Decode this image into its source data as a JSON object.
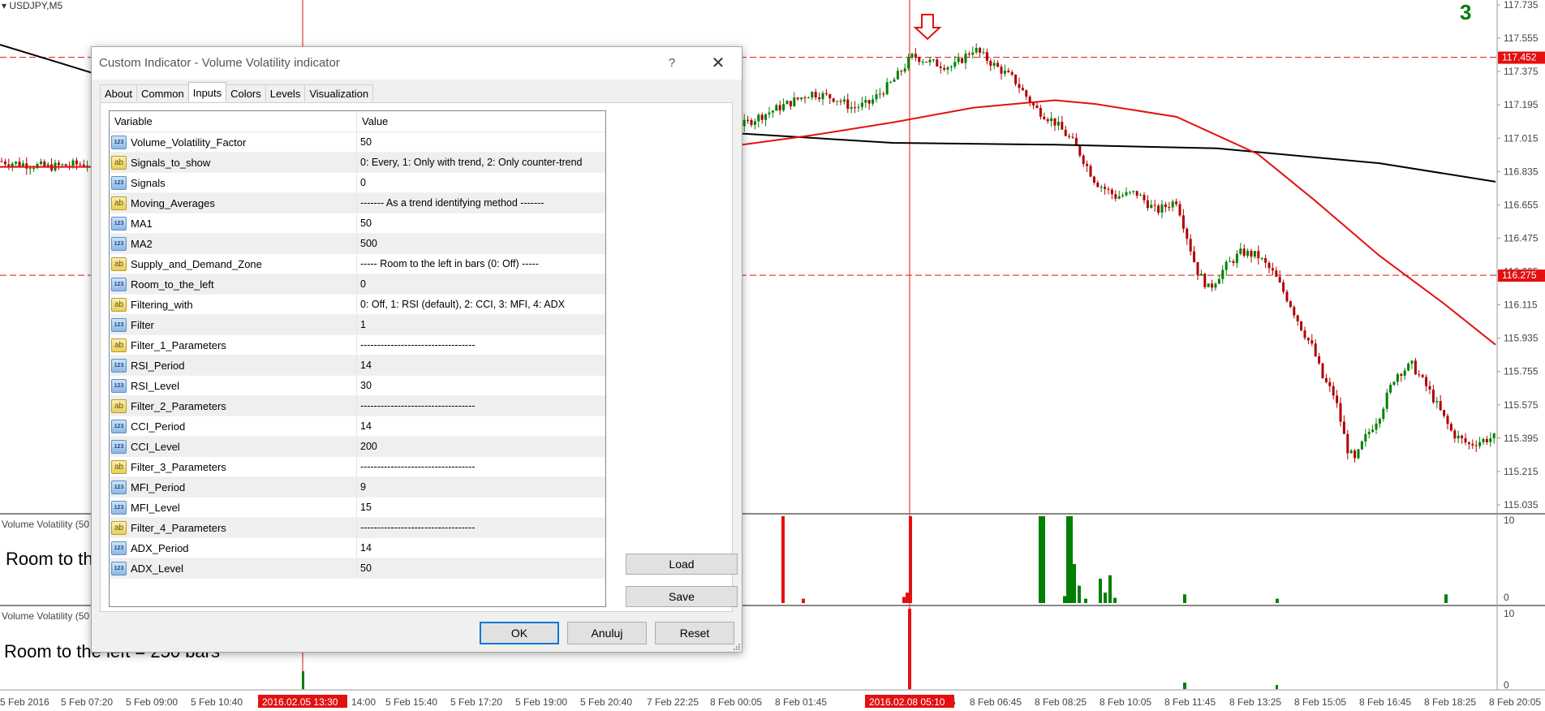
{
  "chart": {
    "symbol_label": "USDJPY,M5",
    "counter": "3",
    "price_ticks": [
      "117.735",
      "117.555",
      "117.375",
      "117.195",
      "117.015",
      "116.835",
      "116.655",
      "116.475",
      "116.295",
      "116.115",
      "115.935",
      "115.755",
      "115.575",
      "115.395",
      "115.215",
      "115.035"
    ],
    "price_tags": [
      {
        "value": "117.452",
        "price": 117.452
      },
      {
        "value": "116.275",
        "price": 116.275
      }
    ],
    "subwindow1": {
      "label": "Volume Volatility (50",
      "note": "Room to th",
      "scale_top": "10",
      "scale_bottom": "0"
    },
    "subwindow2": {
      "label": "Volume Volatility (50",
      "note": "Room to the left = 250 bars",
      "scale_top": "10",
      "scale_bottom": "0"
    },
    "time_labels": [
      "5 Feb 2016",
      "5 Feb 07:20",
      "5 Feb 09:00",
      "5 Feb 10:40",
      "14:00",
      "5 Feb 15:40",
      "5 Feb 17:20",
      "5 Feb 19:00",
      "5 Feb 20:40",
      "7 Feb 22:25",
      "8 Feb 00:05",
      "8 Feb 01:45",
      "5",
      "8 Feb 06:45",
      "8 Feb 08:25",
      "8 Feb 10:05",
      "8 Feb 11:45",
      "8 Feb 13:25",
      "8 Feb 15:05",
      "8 Feb 16:45",
      "8 Feb 18:25",
      "8 Feb 20:05"
    ],
    "time_markers": [
      "2016.02.05 13:30",
      "2016.02.08 05:10"
    ],
    "colors": {
      "bull": "#008000",
      "bear": "#b00000",
      "ma_fast": "#e41010",
      "ma_slow": "#000000",
      "level": "#e41010"
    }
  },
  "dialog": {
    "title": "Custom Indicator - Volume Volatility indicator",
    "help": "?",
    "close": "✕",
    "tabs": [
      "About",
      "Common",
      "Inputs",
      "Colors",
      "Levels",
      "Visualization"
    ],
    "active_tab": "Inputs",
    "grid": {
      "headers": [
        "Variable",
        "Value"
      ],
      "rows": [
        {
          "type": "num",
          "name": "Volume_Volatility_Factor",
          "value": "50"
        },
        {
          "type": "str",
          "name": "Signals_to_show",
          "value": "0: Every, 1: Only with trend, 2: Only counter-trend"
        },
        {
          "type": "num",
          "name": "Signals",
          "value": "0"
        },
        {
          "type": "str",
          "name": "Moving_Averages",
          "value": "------- As a trend identifying method -------"
        },
        {
          "type": "num",
          "name": "MA1",
          "value": "50"
        },
        {
          "type": "num",
          "name": "MA2",
          "value": "500"
        },
        {
          "type": "str",
          "name": "Supply_and_Demand_Zone",
          "value": "----- Room to the left in bars (0: Off) -----"
        },
        {
          "type": "num",
          "name": "Room_to_the_left",
          "value": "0"
        },
        {
          "type": "str",
          "name": "Filtering_with",
          "value": "0: Off, 1: RSI (default), 2: CCI, 3: MFI, 4: ADX"
        },
        {
          "type": "num",
          "name": "Filter",
          "value": "1"
        },
        {
          "type": "str",
          "name": "Filter_1_Parameters",
          "value": "----------------------------------"
        },
        {
          "type": "num",
          "name": "RSI_Period",
          "value": "14"
        },
        {
          "type": "num",
          "name": "RSI_Level",
          "value": "30"
        },
        {
          "type": "str",
          "name": "Filter_2_Parameters",
          "value": "----------------------------------"
        },
        {
          "type": "num",
          "name": "CCI_Period",
          "value": "14"
        },
        {
          "type": "num",
          "name": "CCI_Level",
          "value": "200"
        },
        {
          "type": "str",
          "name": "Filter_3_Parameters",
          "value": "----------------------------------"
        },
        {
          "type": "num",
          "name": "MFI_Period",
          "value": "9"
        },
        {
          "type": "num",
          "name": "MFI_Level",
          "value": "15"
        },
        {
          "type": "str",
          "name": "Filter_4_Parameters",
          "value": "----------------------------------"
        },
        {
          "type": "num",
          "name": "ADX_Period",
          "value": "14"
        },
        {
          "type": "num",
          "name": "ADX_Level",
          "value": "50"
        }
      ]
    },
    "buttons": {
      "load": "Load",
      "save": "Save",
      "ok": "OK",
      "cancel": "Anuluj",
      "reset": "Reset"
    }
  }
}
